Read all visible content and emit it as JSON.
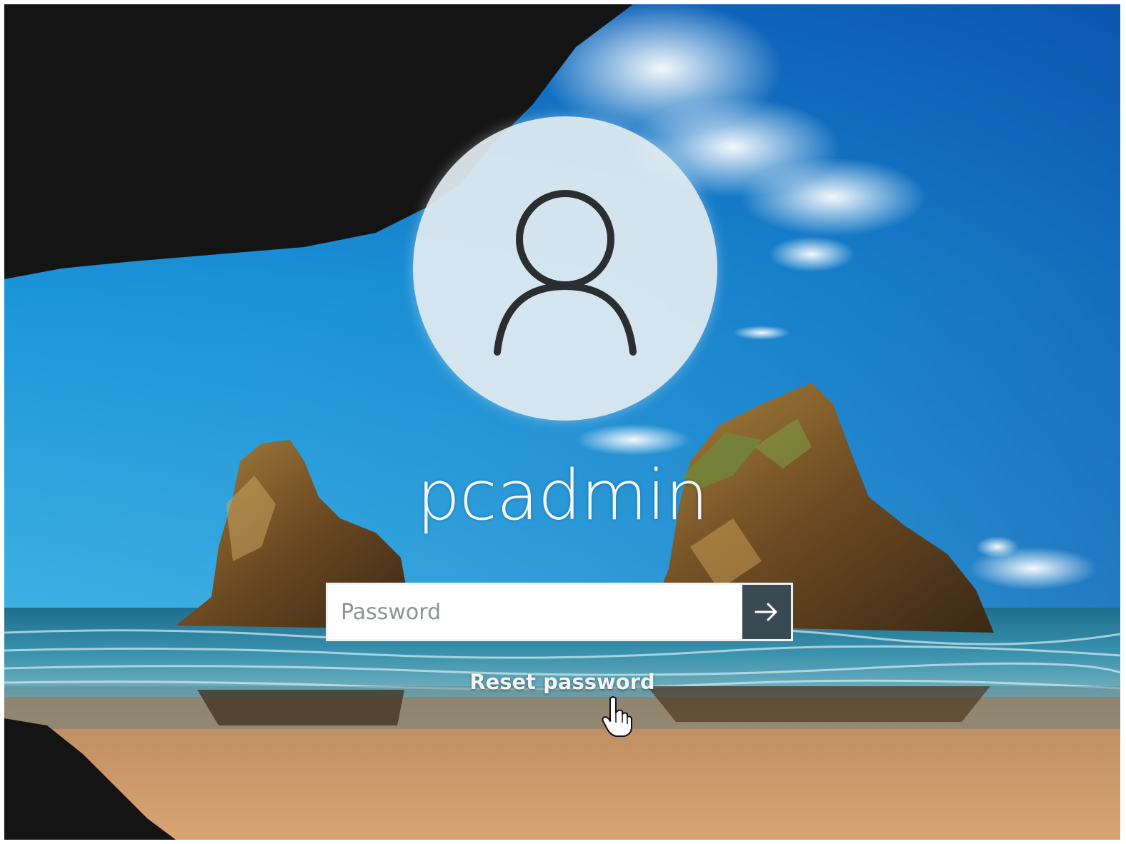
{
  "login": {
    "username": "pcadmin",
    "password_placeholder": "Password",
    "password_value": "",
    "reset_link": "Reset password"
  },
  "icons": {
    "avatar": "user-silhouette-icon",
    "submit": "arrow-right-icon",
    "cursor": "hand-pointer-icon"
  },
  "colors": {
    "sky": "#1a8fd6",
    "sea": "#2b7fa0",
    "sand": "#c89566",
    "cave": "#141414",
    "submit_button": "#3b4a52",
    "avatar_bg": "#e2ecf1"
  }
}
